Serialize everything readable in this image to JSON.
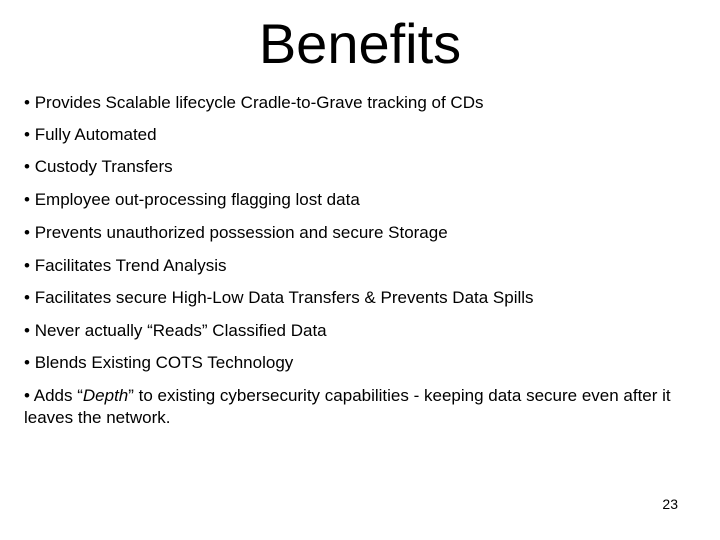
{
  "slide": {
    "title": "Benefits",
    "bullet_char": "•",
    "bullets": [
      {
        "text": "Provides Scalable lifecycle Cradle-to-Grave tracking of CDs"
      },
      {
        "text": "Fully Automated"
      },
      {
        "text": "Custody Transfers"
      },
      {
        "text": "Employee out-processing flagging lost data"
      },
      {
        "text": "Prevents unauthorized possession and secure Storage"
      },
      {
        "text": "Facilitates Trend Analysis"
      },
      {
        "text": "Facilitates secure High-Low Data Transfers & Prevents Data Spills"
      },
      {
        "text": "Never actually “Reads” Classified Data"
      },
      {
        "text": "Blends Existing COTS Technology"
      },
      {
        "prefix": "Adds “",
        "emphasis": "Depth",
        "suffix": "” to existing cybersecurity capabilities - keeping data secure even after it leaves the network."
      }
    ],
    "page_number": "23"
  }
}
